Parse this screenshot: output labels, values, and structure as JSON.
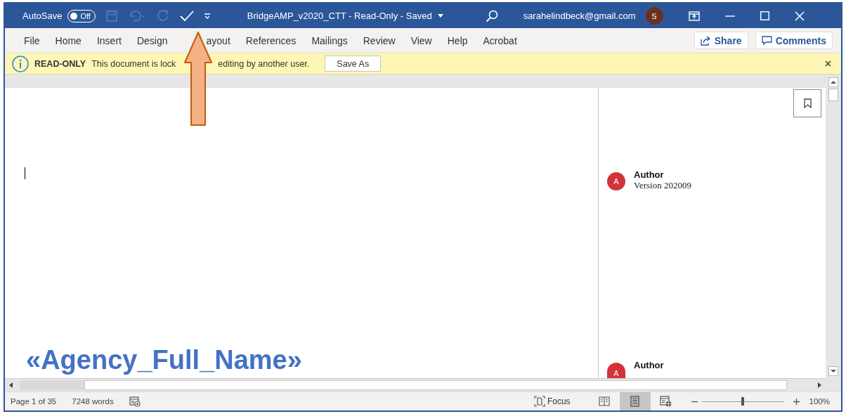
{
  "title_bar": {
    "autosave_label": "AutoSave",
    "autosave_toggle": {
      "label": "Off",
      "on": false
    },
    "document_title": "BridgeAMP_v2020_CTT  -  Read-Only  -  Saved",
    "account": "sarahelindbeck@gmail.com",
    "avatar_initial": "S"
  },
  "ribbon_tabs": [
    "File",
    "Home",
    "Insert",
    "Design",
    "ayout",
    "References",
    "Mailings",
    "Review",
    "View",
    "Help",
    "Acrobat"
  ],
  "share_button": "Share",
  "comments_button": "Comments",
  "message_bar": {
    "title": "READ-ONLY",
    "message_parts": [
      "This document is lock",
      "editing by another user."
    ],
    "button": "Save As"
  },
  "document": {
    "merge_field": "«Agency_Full_Name»"
  },
  "comments": [
    {
      "avatar": "A",
      "author": "Author",
      "text": "Version 202009"
    },
    {
      "avatar": "A",
      "author": "Author"
    }
  ],
  "status_bar": {
    "page": "Page 1 of 35",
    "words": "7248 words",
    "focus": "Focus",
    "views": [
      {
        "kind": "read",
        "selected": false
      },
      {
        "kind": "print",
        "selected": true
      },
      {
        "kind": "web",
        "selected": false
      }
    ],
    "zoom": {
      "level": 0.5,
      "value": "100%"
    }
  }
}
